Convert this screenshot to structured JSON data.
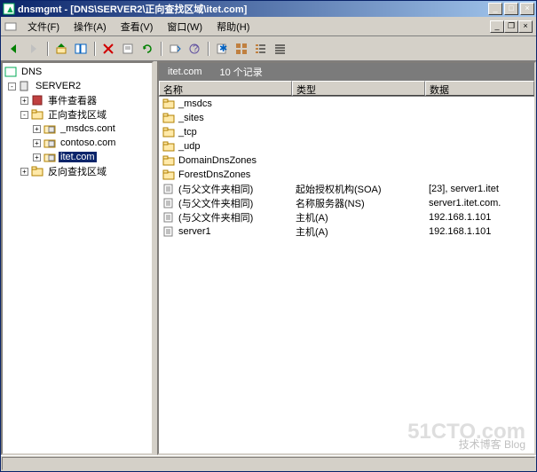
{
  "title": "dnsmgmt - [DNS\\SERVER2\\正向查找区域\\itet.com]",
  "menu": {
    "file": "文件(F)",
    "action": "操作(A)",
    "view": "查看(V)",
    "window": "窗口(W)",
    "help": "帮助(H)"
  },
  "tree": {
    "root": "DNS",
    "server": "SERVER2",
    "event_viewer": "事件查看器",
    "forward_zone": "正向查找区域",
    "z1": "_msdcs.cont",
    "z2": "contoso.com",
    "z3": "itet.com",
    "reverse_zone": "反向查找区域"
  },
  "zone_header": {
    "name": "itet.com",
    "count": "10 个记录"
  },
  "columns": {
    "name": "名称",
    "type": "类型",
    "data": "数据"
  },
  "rows": [
    {
      "icon": "folder",
      "name": "_msdcs",
      "type": "",
      "data": ""
    },
    {
      "icon": "folder",
      "name": "_sites",
      "type": "",
      "data": ""
    },
    {
      "icon": "folder",
      "name": "_tcp",
      "type": "",
      "data": ""
    },
    {
      "icon": "folder",
      "name": "_udp",
      "type": "",
      "data": ""
    },
    {
      "icon": "folder",
      "name": "DomainDnsZones",
      "type": "",
      "data": ""
    },
    {
      "icon": "folder",
      "name": "ForestDnsZones",
      "type": "",
      "data": ""
    },
    {
      "icon": "record",
      "name": "(与父文件夹相同)",
      "type": "起始授权机构(SOA)",
      "data": "[23], server1.itet"
    },
    {
      "icon": "record",
      "name": "(与父文件夹相同)",
      "type": "名称服务器(NS)",
      "data": "server1.itet.com."
    },
    {
      "icon": "record",
      "name": "(与父文件夹相同)",
      "type": "主机(A)",
      "data": "192.168.1.101"
    },
    {
      "icon": "record",
      "name": "server1",
      "type": "主机(A)",
      "data": "192.168.1.101"
    }
  ],
  "watermark": "51CTO.com",
  "watermark2": "技术博客 Blog"
}
